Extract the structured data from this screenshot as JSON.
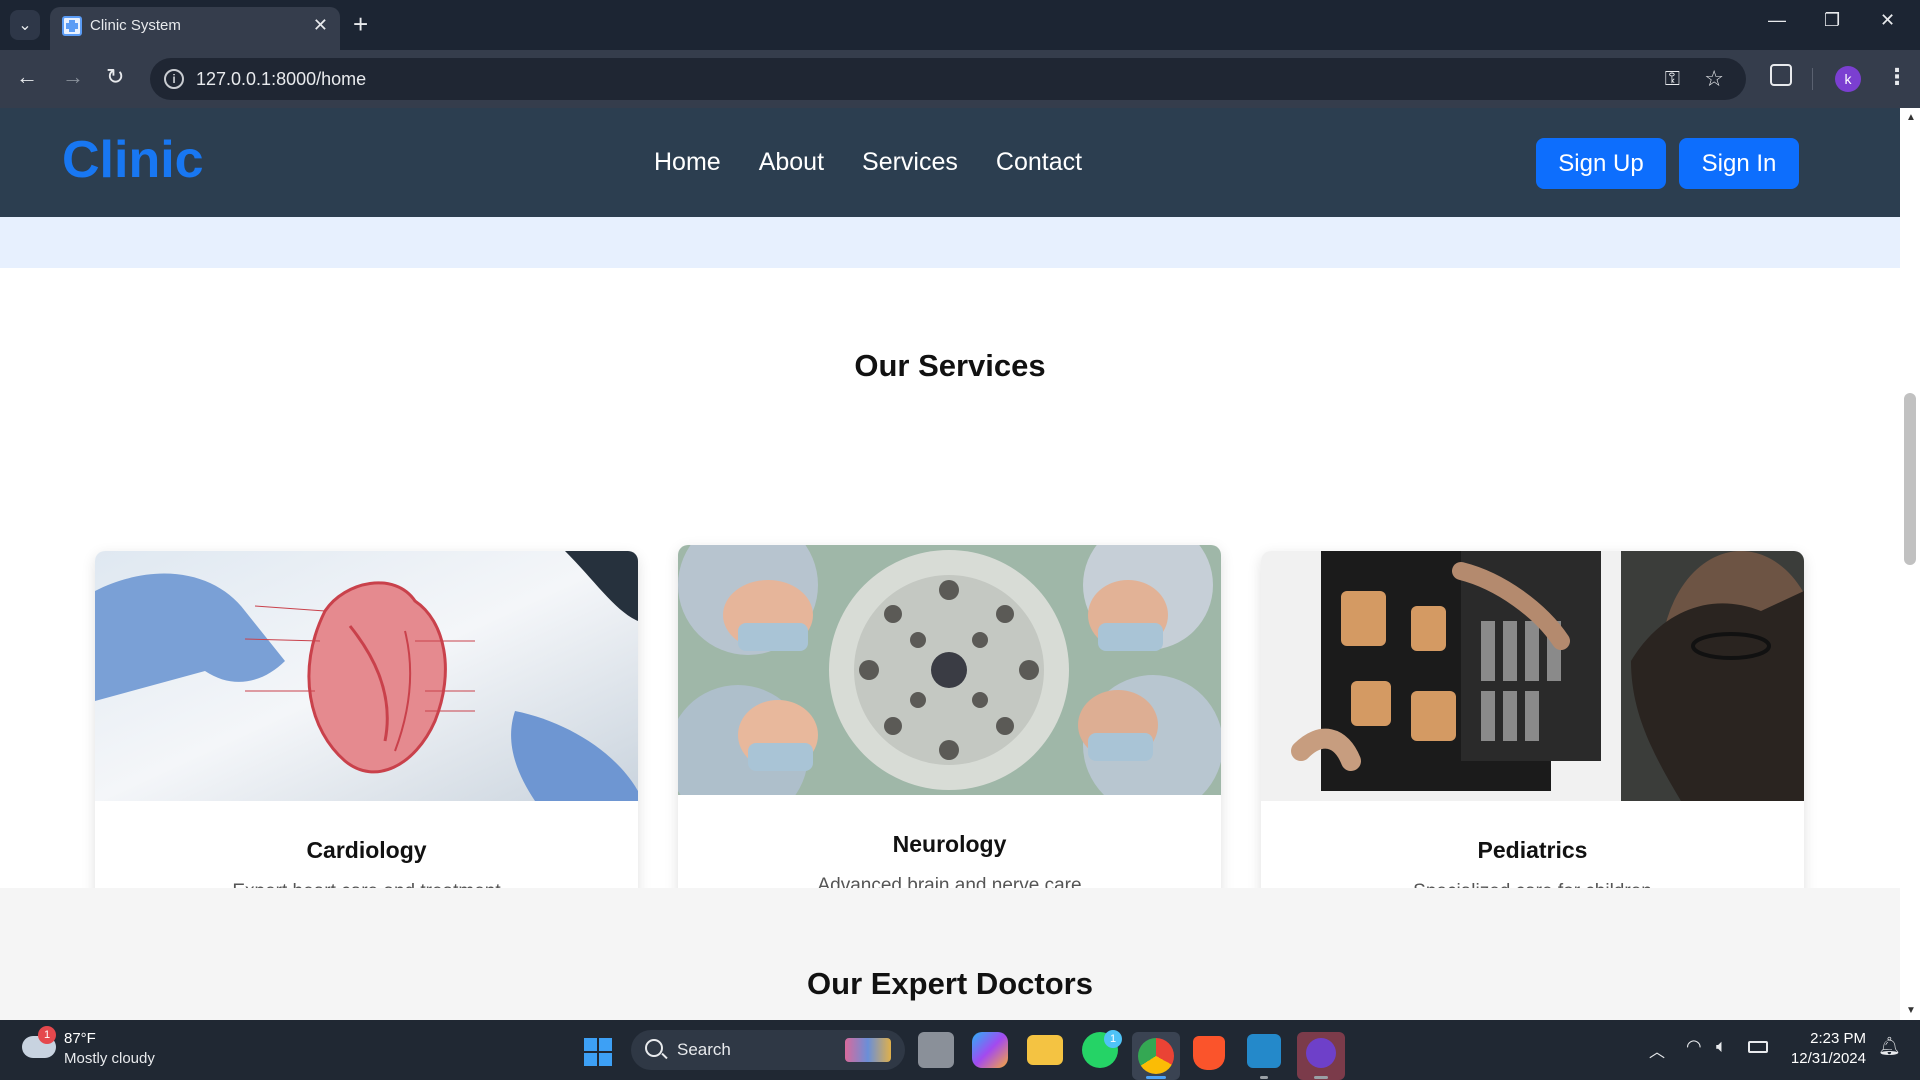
{
  "browser": {
    "tab_title": "Clinic System",
    "url": "127.0.0.1:8000/home",
    "profile_initial": "k"
  },
  "site": {
    "logo": "Clinic",
    "nav": [
      "Home",
      "About",
      "Services",
      "Contact"
    ],
    "signup_label": "Sign Up",
    "signin_label": "Sign In",
    "brand_color": "#1877f2",
    "header_bg": "#2c3e50",
    "button_color": "#0d6efd"
  },
  "services": {
    "title": "Our Services",
    "cards": [
      {
        "title": "Cardiology",
        "desc": "Expert heart care and treatment",
        "image": "heart-anatomy-photo"
      },
      {
        "title": "Neurology",
        "desc": "Advanced brain and nerve care",
        "image": "surgeons-operating-light-photo"
      },
      {
        "title": "Pediatrics",
        "desc": "Specialized care for children",
        "image": "doctor-xray-photo"
      }
    ]
  },
  "doctors": {
    "title": "Our Expert Doctors"
  },
  "taskbar": {
    "weather_temp": "87°F",
    "weather_desc": "Mostly cloudy",
    "weather_badge": "1",
    "search_label": "Search",
    "whatsapp_badge": "1",
    "time": "2:23 PM",
    "date": "12/31/2024"
  }
}
